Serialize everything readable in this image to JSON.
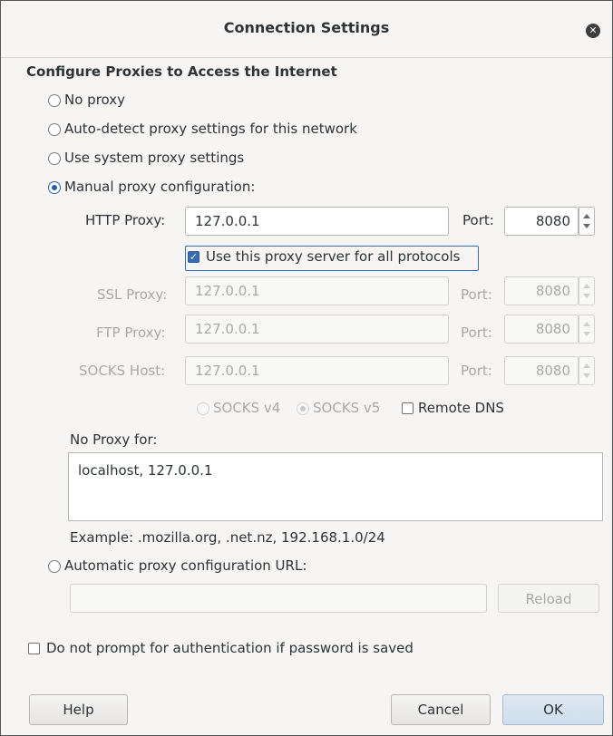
{
  "window": {
    "title": "Connection Settings"
  },
  "section_title": "Configure Proxies to Access the Internet",
  "proxy_modes": {
    "no_proxy": "No proxy",
    "auto_detect": "Auto-detect proxy settings for this network",
    "system": "Use system proxy settings",
    "manual": "Manual proxy configuration:",
    "auto_url": "Automatic proxy configuration URL:",
    "selected": "manual"
  },
  "manual": {
    "http": {
      "label": "HTTP Proxy:",
      "value": "127.0.0.1",
      "port_label": "Port:",
      "port": "8080"
    },
    "use_for_all": {
      "label": "Use this proxy server for all protocols",
      "checked": true
    },
    "ssl": {
      "label": "SSL Proxy:",
      "value": "127.0.0.1",
      "port_label": "Port:",
      "port": "8080"
    },
    "ftp": {
      "label": "FTP Proxy:",
      "value": "127.0.0.1",
      "port_label": "Port:",
      "port": "8080"
    },
    "socks": {
      "label": "SOCKS Host:",
      "value": "127.0.0.1",
      "port_label": "Port:",
      "port": "8080"
    },
    "socks_v4": "SOCKS v4",
    "socks_v5": "SOCKS v5",
    "remote_dns": "Remote DNS"
  },
  "no_proxy": {
    "label": "No Proxy for:",
    "value": "localhost, 127.0.0.1",
    "example": "Example: .mozilla.org, .net.nz, 192.168.1.0/24"
  },
  "auto_url": {
    "value": "",
    "reload_label": "Reload"
  },
  "auth_prompt": {
    "label": "Do not prompt for authentication if password is saved",
    "checked": false
  },
  "buttons": {
    "help": "Help",
    "cancel": "Cancel",
    "ok": "OK"
  }
}
